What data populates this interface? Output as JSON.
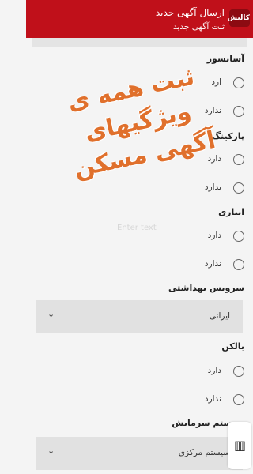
{
  "header": {
    "title": "ارسال آگهی جدید",
    "subtitle": "ثبت آگهی جدید",
    "logo_text": "کالیش"
  },
  "sections": {
    "elevator": {
      "label": "آسانسور",
      "options": [
        {
          "label": "ارد",
          "selected": false
        },
        {
          "label": "ندارد",
          "selected": false
        }
      ]
    },
    "parking": {
      "label": "پارکینگ",
      "options": [
        {
          "label": "دارد",
          "selected": false
        },
        {
          "label": "ندارد",
          "selected": false
        }
      ]
    },
    "storage": {
      "label": "انباری",
      "options": [
        {
          "label": "دارد",
          "selected": false
        },
        {
          "label": "ندارد",
          "selected": false
        }
      ]
    },
    "sanitary": {
      "label": "سرویس بهداشتی",
      "selected_value": "ایرانی"
    },
    "balcony": {
      "label": "بالکن",
      "options": [
        {
          "label": "دارد",
          "selected": false
        },
        {
          "label": "ندارد",
          "selected": false
        }
      ]
    },
    "cooling": {
      "label": "سیستم سرمایش",
      "selected_value": "سیستم مرکزی"
    }
  },
  "watermark": {
    "line1": "ثبت همه ی ویژگیهای",
    "line2": "آگهی مسکن"
  },
  "faint_text": "Enter text",
  "colors": {
    "appbar": "#c0101a",
    "background": "#f4f4f4",
    "select_bg": "#e1e1e1",
    "overlay_text": "#e0702c"
  },
  "icons": {
    "dropdown": "chevron-down-icon",
    "radio": "radio-unchecked-icon",
    "badge": "store-badge-icon"
  }
}
